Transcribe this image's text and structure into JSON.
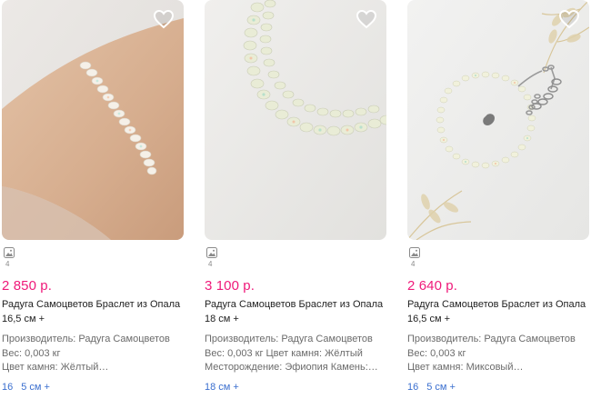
{
  "products": [
    {
      "photo": "opal-bracelet-on-wrist",
      "gallery_count": "4",
      "price": "2 850 р.",
      "title_line1": "Радуга Самоцветов Браслет из Опала",
      "title_line2": "16,5 см +",
      "meta_line1": "Производитель: Радуга Самоцветов",
      "meta_line2": "Вес: 0,003 кг",
      "meta_line3": "Цвет камня: Жёлтый…",
      "sizes": [
        "16",
        "5 см +"
      ]
    },
    {
      "photo": "opal-bead-strand-closeup",
      "gallery_count": "4",
      "price": "3 100 р.",
      "title_line1": "Радуга Самоцветов Браслет из Опала",
      "title_line2": "18 см +",
      "meta_line1": "Производитель: Радуга Самоцветов",
      "meta_line2": "Вес: 0,003 кг Цвет камня: Жёлтый",
      "meta_line3": "Месторождение: Эфиопия Камень:…",
      "sizes": [
        "18 см +"
      ]
    },
    {
      "photo": "opal-bracelet-with-clasp",
      "gallery_count": "4",
      "price": "2 640 р.",
      "title_line1": "Радуга Самоцветов Браслет из Опала",
      "title_line2": "16,5 см +",
      "meta_line1": "Производитель: Радуга Самоцветов",
      "meta_line2": "Вес: 0,003 кг",
      "meta_line3": "Цвет камня: Миксовый…",
      "sizes": [
        "16",
        "5 см +"
      ]
    }
  ],
  "icons": {
    "favorite": "heart-outline-icon",
    "gallery": "image-stack-icon"
  },
  "colors": {
    "price": "#ef1a7a",
    "link": "#3b6fcf",
    "meta": "#6b6b6b"
  }
}
